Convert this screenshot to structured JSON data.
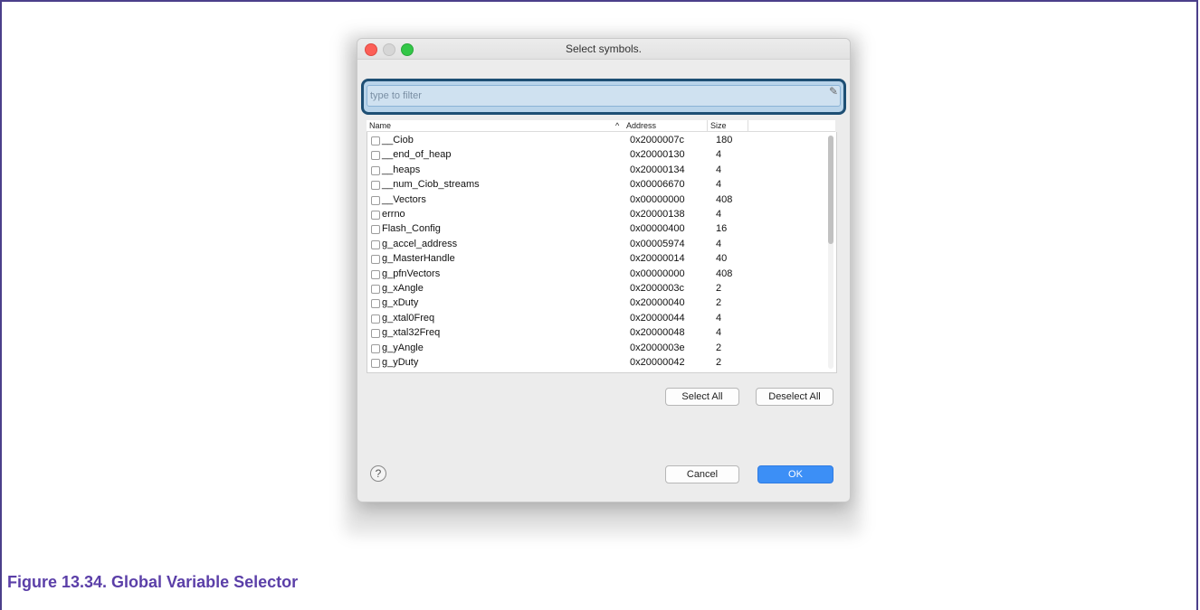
{
  "dialog": {
    "title": "Select symbols.",
    "filter": {
      "placeholder": "type to filter",
      "icon": "clear-icon"
    },
    "table": {
      "headers": {
        "name": "Name",
        "address": "Address",
        "size": "Size"
      },
      "sort_indicator": "^",
      "rows": [
        {
          "name": "__Ciob",
          "address": "0x2000007c",
          "size": "180"
        },
        {
          "name": "__end_of_heap",
          "address": "0x20000130",
          "size": "4"
        },
        {
          "name": "__heaps",
          "address": "0x20000134",
          "size": "4"
        },
        {
          "name": "__num_Ciob_streams",
          "address": "0x00006670",
          "size": "4"
        },
        {
          "name": "__Vectors",
          "address": "0x00000000",
          "size": "408"
        },
        {
          "name": "errno",
          "address": "0x20000138",
          "size": "4"
        },
        {
          "name": "Flash_Config",
          "address": "0x00000400",
          "size": "16"
        },
        {
          "name": "g_accel_address",
          "address": "0x00005974",
          "size": "4"
        },
        {
          "name": "g_MasterHandle",
          "address": "0x20000014",
          "size": "40"
        },
        {
          "name": "g_pfnVectors",
          "address": "0x00000000",
          "size": "408"
        },
        {
          "name": "g_xAngle",
          "address": "0x2000003c",
          "size": "2"
        },
        {
          "name": "g_xDuty",
          "address": "0x20000040",
          "size": "2"
        },
        {
          "name": "g_xtal0Freq",
          "address": "0x20000044",
          "size": "4"
        },
        {
          "name": "g_xtal32Freq",
          "address": "0x20000048",
          "size": "4"
        },
        {
          "name": "g_yAngle",
          "address": "0x2000003e",
          "size": "2"
        },
        {
          "name": "g_yDuty",
          "address": "0x20000042",
          "size": "2"
        }
      ]
    },
    "buttons": {
      "select_all": "Select All",
      "deselect_all": "Deselect All",
      "cancel": "Cancel",
      "ok": "OK",
      "help": "?"
    }
  },
  "caption": "Figure 13.34. Global Variable Selector",
  "colors": {
    "accent": "#3c8ff6",
    "caption": "#5b3fa8",
    "filter_focus": "#1e4f74"
  }
}
